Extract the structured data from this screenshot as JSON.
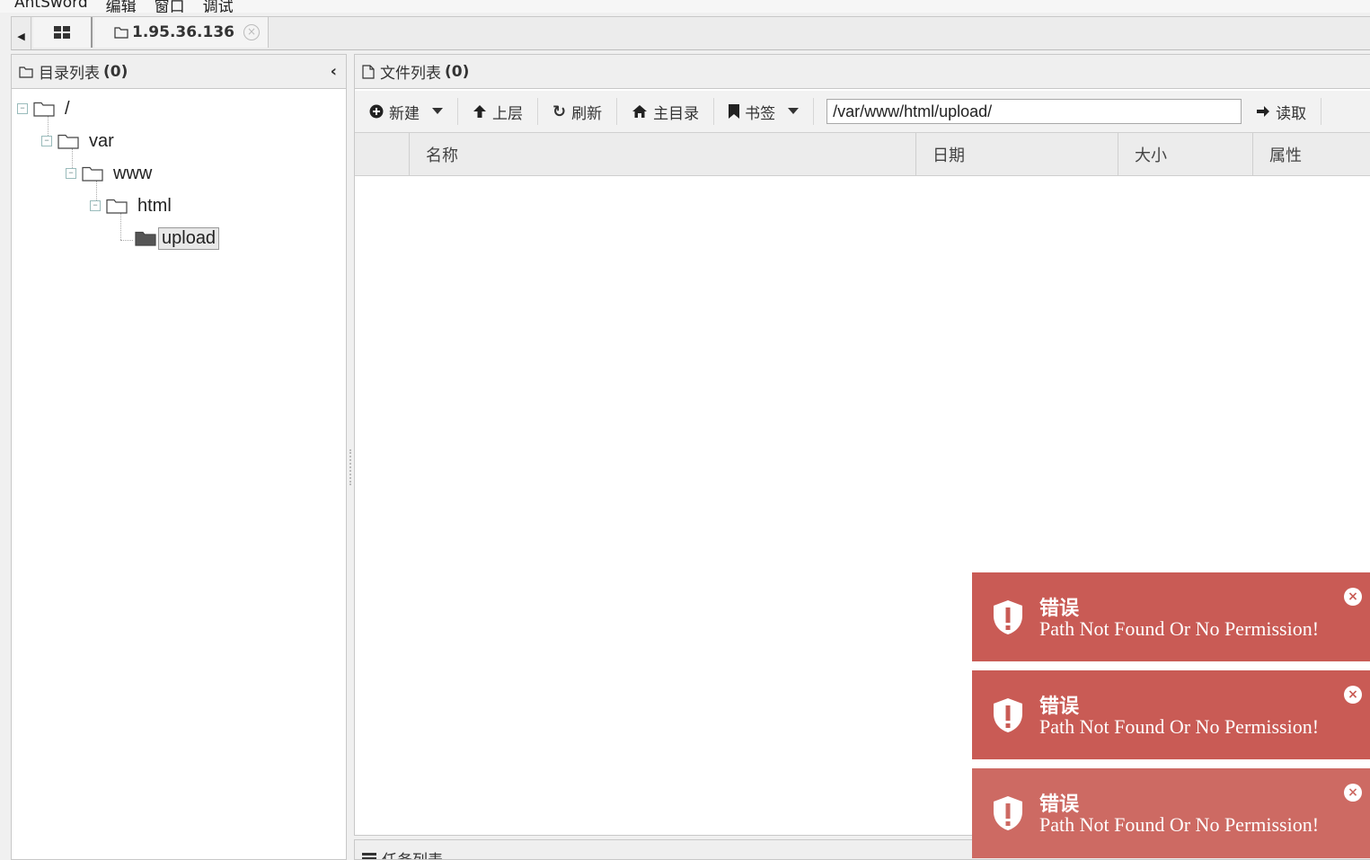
{
  "menu": [
    "AntSword",
    "编辑",
    "窗口",
    "调试"
  ],
  "tabs": {
    "host": "1.95.36.136"
  },
  "left_panel": {
    "title": "目录列表",
    "count": "(0)",
    "tree": [
      {
        "label": "/"
      },
      {
        "label": "var"
      },
      {
        "label": "www"
      },
      {
        "label": "html"
      },
      {
        "label": "upload"
      }
    ]
  },
  "right_panel": {
    "title": "文件列表",
    "count": "(0)",
    "toolbar": {
      "new_label": "新建",
      "up_label": "上层",
      "refresh_label": "刷新",
      "home_label": "主目录",
      "bookmark_label": "书签",
      "path_value": "/var/www/html/upload/",
      "read_label": "读取"
    },
    "columns": [
      "名称",
      "日期",
      "大小",
      "属性"
    ]
  },
  "task_panel": {
    "title": "任务列表"
  },
  "toasts": [
    {
      "title": "错误",
      "message": "Path Not Found Or No Permission!"
    },
    {
      "title": "错误",
      "message": "Path Not Found Or No Permission!"
    },
    {
      "title": "错误",
      "message": "Path Not Found Or No Permission!"
    }
  ],
  "colors": {
    "toast_bg": "#c95b55",
    "panel_bg": "#f0f0f0"
  }
}
